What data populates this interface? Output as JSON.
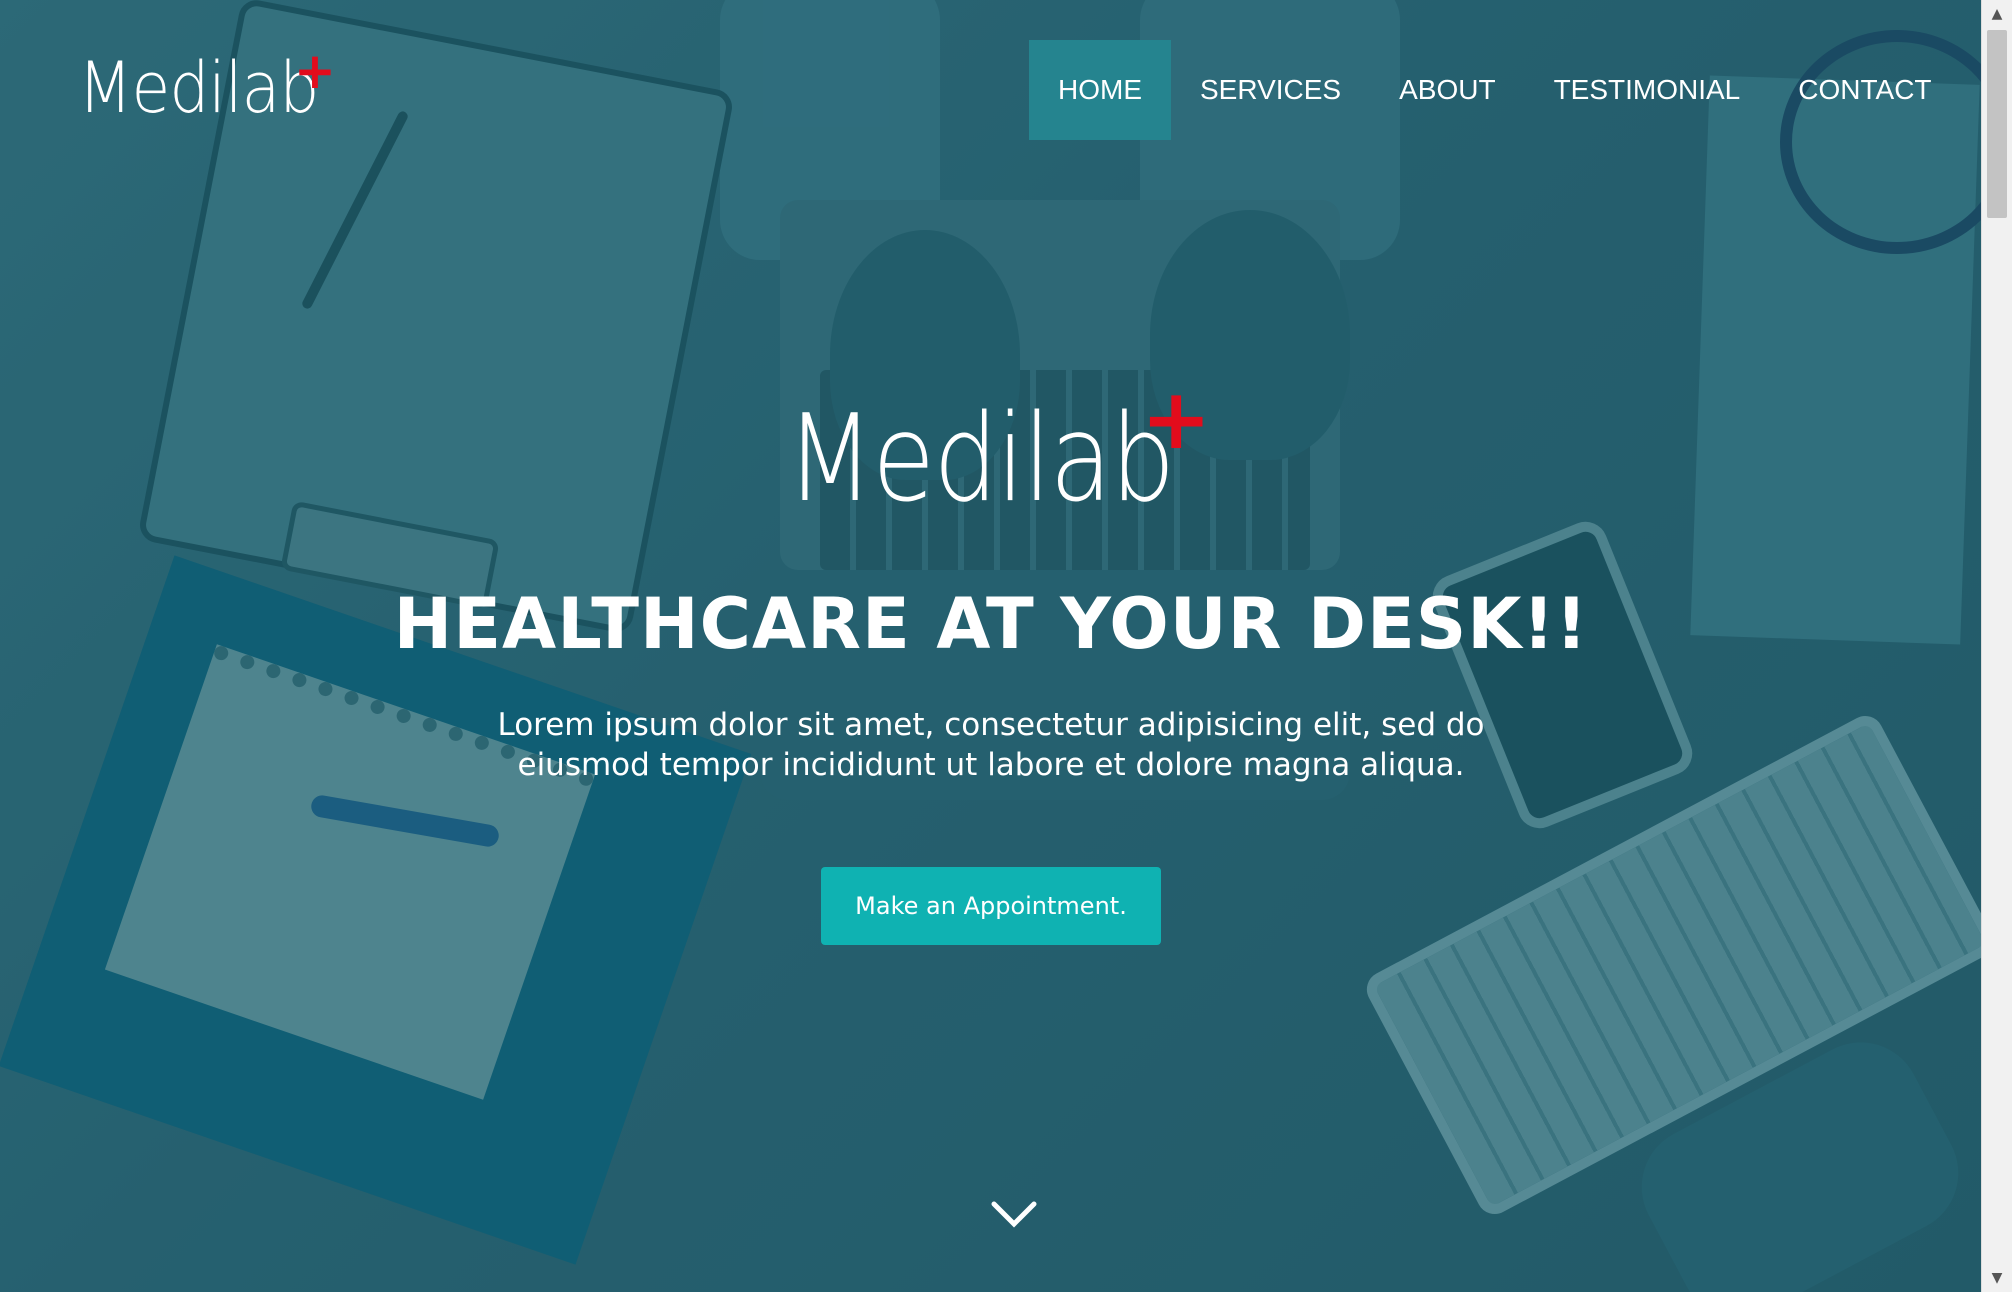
{
  "brand": {
    "logo_text": "Medilab",
    "logo_mark": "+",
    "accent_color": "#e20c1c"
  },
  "nav": {
    "items": [
      {
        "label": "HOME",
        "active": true
      },
      {
        "label": "SERVICES",
        "active": false
      },
      {
        "label": "ABOUT",
        "active": false
      },
      {
        "label": "TESTIMONIAL",
        "active": false
      },
      {
        "label": "CONTACT",
        "active": false
      }
    ],
    "active_color": "#25848f"
  },
  "hero": {
    "logo_text": "Medilab",
    "logo_mark": "+",
    "title": "HEALTHCARE AT YOUR DESK!!",
    "text": "Lorem ipsum dolor sit amet, consectetur adipisicing elit, sed do eiusmod tempor incididunt ut labore et dolore magna aliqua.",
    "cta_label": "Make an Appointment.",
    "cta_color": "#0fb2b2",
    "scroll_icon": "chevron-down-icon"
  },
  "scrollbar": {
    "up_icon": "▲",
    "down_icon": "▼"
  }
}
